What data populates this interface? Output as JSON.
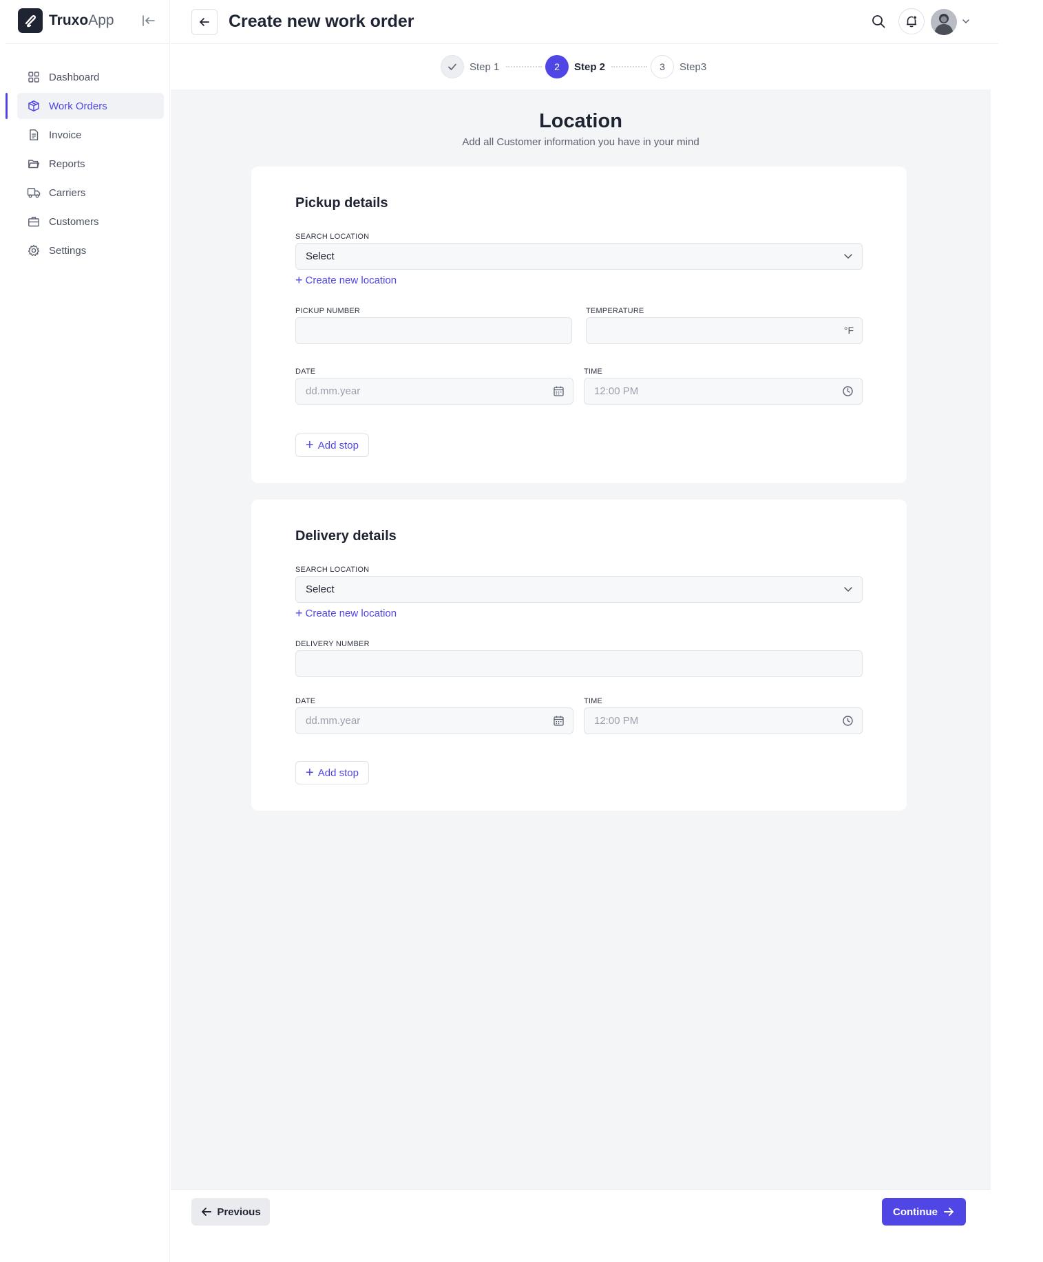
{
  "app": {
    "brand_bold": "Truxo",
    "brand_light": "App"
  },
  "colors": {
    "accent": "#4f46e5",
    "text": "#1f2433",
    "muted": "#5b6170",
    "background": "#f4f5f7"
  },
  "sidebar": {
    "items": [
      {
        "label": "Dashboard",
        "icon": "dashboard-icon",
        "active": false
      },
      {
        "label": "Work Orders",
        "icon": "box-icon",
        "active": true
      },
      {
        "label": "Invoice",
        "icon": "document-icon",
        "active": false
      },
      {
        "label": "Reports",
        "icon": "folder-icon",
        "active": false
      },
      {
        "label": "Carriers",
        "icon": "truck-icon",
        "active": false
      },
      {
        "label": "Customers",
        "icon": "briefcase-icon",
        "active": false
      },
      {
        "label": "Settings",
        "icon": "gear-icon",
        "active": false
      }
    ]
  },
  "header": {
    "title": "Create new work order"
  },
  "stepper": {
    "steps": [
      {
        "label": "Step 1",
        "state": "done",
        "number": ""
      },
      {
        "label": "Step 2",
        "state": "current",
        "number": "2"
      },
      {
        "label": "Step3",
        "state": "todo",
        "number": "3"
      }
    ]
  },
  "main": {
    "title": "Location",
    "subtitle": "Add all Customer information you have in your mind"
  },
  "pickup": {
    "title": "Pickup details",
    "search_label": "SEARCH LOCATION",
    "search_value": "Select",
    "create_link": "Create new location",
    "number_label": "PICKUP NUMBER",
    "number_value": "",
    "temperature_label": "TEMPERATURE",
    "temperature_value": "",
    "temperature_unit": "°F",
    "date_label": "DATE",
    "date_placeholder": "dd.mm.year",
    "time_label": "TIME",
    "time_placeholder": "12:00 PM",
    "add_stop": "Add stop"
  },
  "delivery": {
    "title": "Delivery details",
    "search_label": "SEARCH LOCATION",
    "search_value": "Select",
    "create_link": "Create new location",
    "number_label": "DELIVERY NUMBER",
    "number_value": "",
    "date_label": "DATE",
    "date_placeholder": "dd.mm.year",
    "time_label": "TIME",
    "time_placeholder": "12:00 PM",
    "add_stop": "Add stop"
  },
  "footer": {
    "previous": "Previous",
    "continue": "Continue"
  }
}
